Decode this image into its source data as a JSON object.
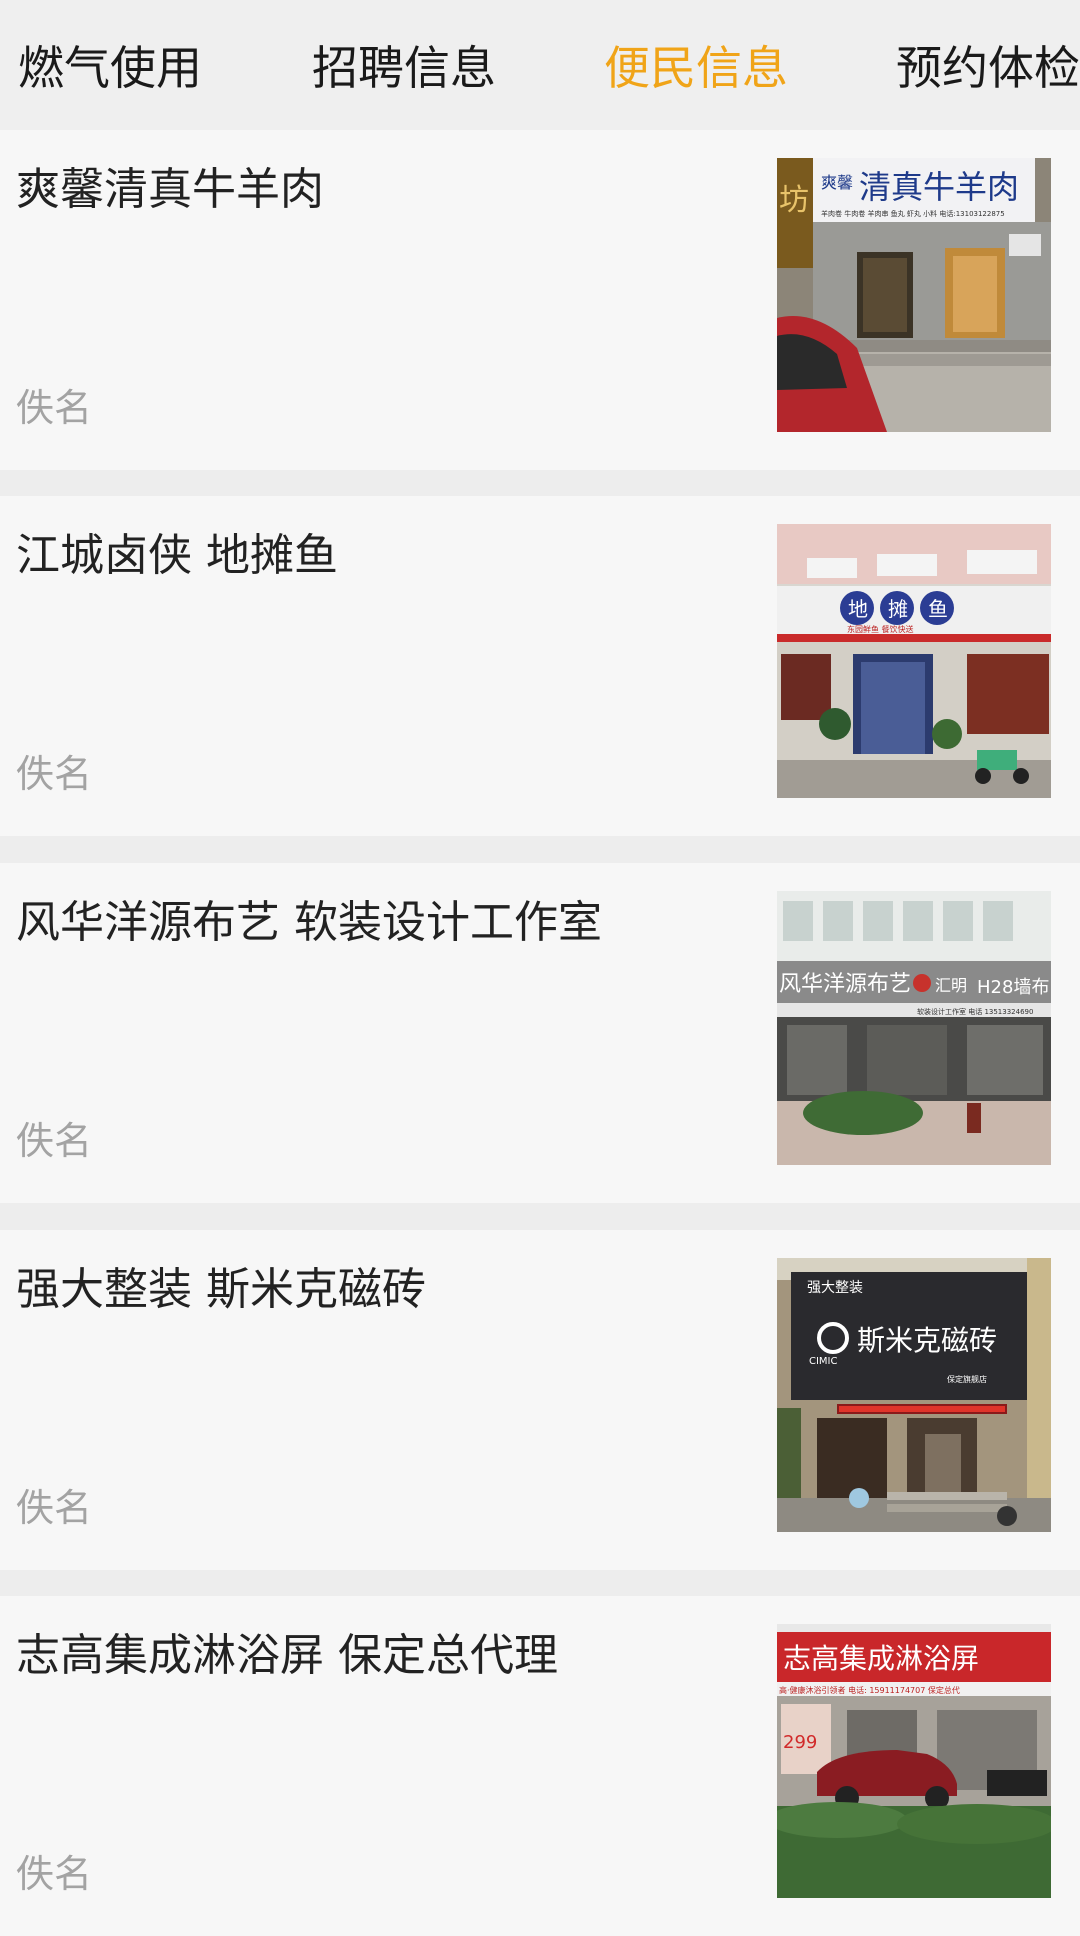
{
  "tabs": [
    {
      "label": "燃气使用",
      "active": false
    },
    {
      "label": "招聘信息",
      "active": false
    },
    {
      "label": "便民信息",
      "active": true
    },
    {
      "label": "预约体检",
      "active": false
    }
  ],
  "colors": {
    "active_tab": "#f0a418",
    "title_text": "#222222",
    "author_text": "#a3a3a3",
    "card_bg": "#f7f7f7",
    "separator": "#ededed"
  },
  "articles": [
    {
      "title": "爽馨清真牛羊肉",
      "author": "佚名",
      "image": {
        "description": "storefront photo",
        "sign_text": "清真牛羊肉",
        "sign_small": "爽馨",
        "sign_sub": "羊肉卷 牛肉卷 羊肉串 鱼丸 虾丸 小料 电话:13103122875",
        "side_char": "坊"
      }
    },
    {
      "title": "江城卤侠 地摊鱼",
      "author": "佚名",
      "image": {
        "description": "storefront photo",
        "sign_chars": [
          "地",
          "摊",
          "鱼"
        ],
        "sign_sub": "东园鲜鱼 餐饮快送"
      }
    },
    {
      "title": "风华洋源布艺 软装设计工作室",
      "author": "佚名",
      "image": {
        "description": "storefront photo",
        "sign_text": "风华洋源布艺",
        "sign_brand": "汇明",
        "sign_right": "H28墙布",
        "sign_sub": "软装设计工作室 电话 13513324690"
      }
    },
    {
      "title": "强大整装 斯米克磁砖",
      "author": "佚名",
      "image": {
        "description": "storefront photo",
        "sign_top": "强大整装",
        "sign_text": "斯米克磁砖",
        "sign_brand": "CIMIC",
        "sign_sub": "保定旗舰店"
      }
    },
    {
      "title": "志高集成淋浴屏  保定总代理",
      "author": "佚名",
      "image": {
        "description": "storefront photo",
        "sign_text": "志高集成淋浴屏",
        "sign_sub": "高·健康沐浴引领者  电话: 15911174707  保定总代",
        "promo": "299"
      }
    }
  ]
}
